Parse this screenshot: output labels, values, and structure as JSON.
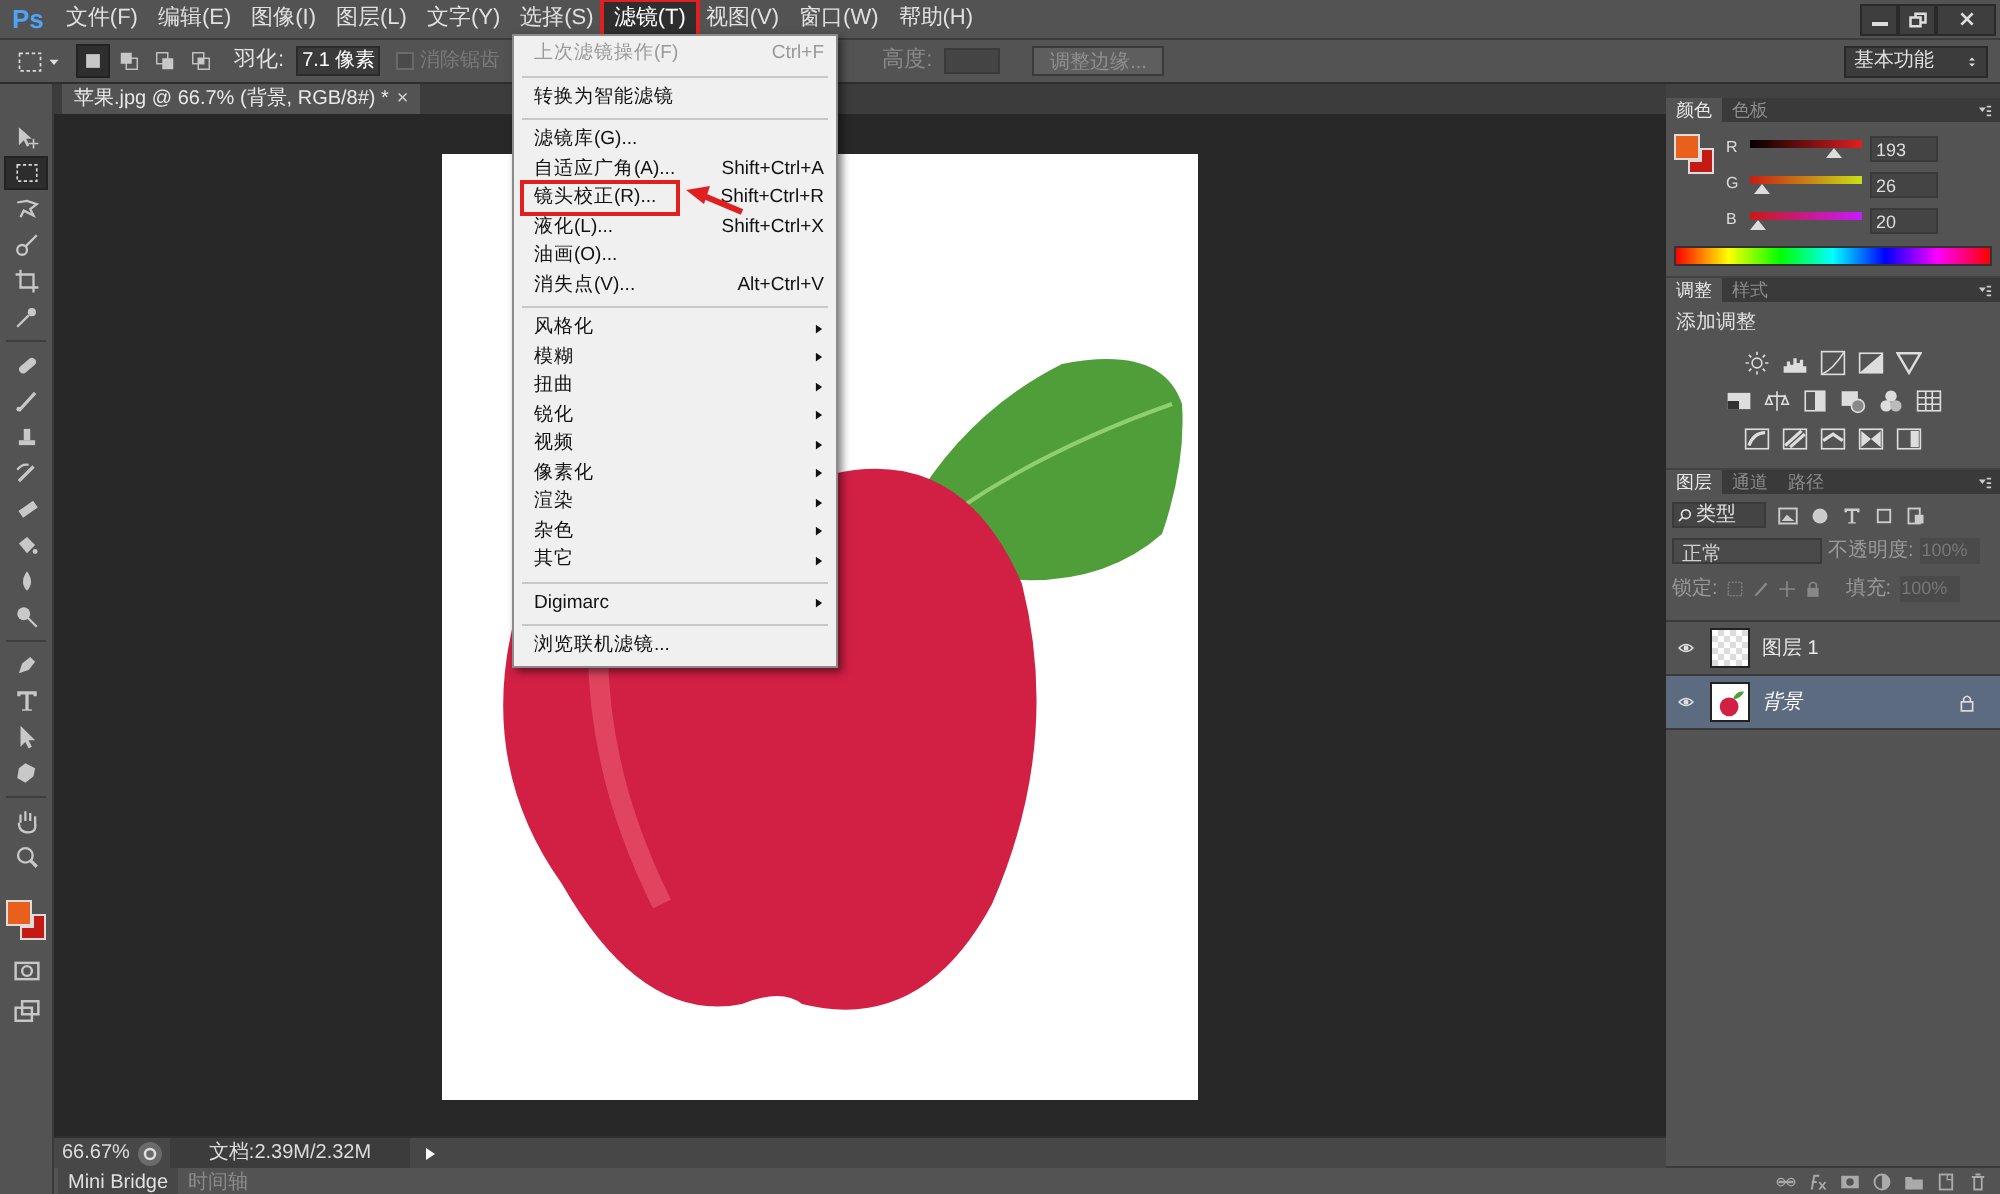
{
  "app_logo": "Ps",
  "menubar": [
    {
      "label": "文件(F)",
      "selected": false,
      "annotated": false
    },
    {
      "label": "编辑(E)",
      "selected": false,
      "annotated": false
    },
    {
      "label": "图像(I)",
      "selected": false,
      "annotated": false
    },
    {
      "label": "图层(L)",
      "selected": false,
      "annotated": false
    },
    {
      "label": "文字(Y)",
      "selected": false,
      "annotated": false
    },
    {
      "label": "选择(S)",
      "selected": false,
      "annotated": false
    },
    {
      "label": "滤镜(T)",
      "selected": true,
      "annotated": true
    },
    {
      "label": "视图(V)",
      "selected": false,
      "annotated": false
    },
    {
      "label": "窗口(W)",
      "selected": false,
      "annotated": false
    },
    {
      "label": "帮助(H)",
      "selected": false,
      "annotated": false
    }
  ],
  "options_bar": {
    "modes": [
      {
        "selected": true
      },
      {
        "selected": false
      },
      {
        "selected": false
      },
      {
        "selected": false
      }
    ],
    "feather_label": "羽化:",
    "feather_value": "7.1 像素",
    "antialias": {
      "label": "消除锯齿",
      "checked": false,
      "disabled": true
    },
    "height_label": "高度:",
    "refine_button": "调整边缘...",
    "workspace": "基本功能"
  },
  "document_tab": {
    "title": "苹果.jpg @ 66.7% (背景, RGB/8#) *",
    "close": "×"
  },
  "tools": [
    {
      "kind": "move",
      "selected": false
    },
    {
      "kind": "marquee",
      "selected": true
    },
    {
      "kind": "lasso",
      "selected": false
    },
    {
      "kind": "quick-select",
      "selected": false
    },
    {
      "kind": "crop",
      "selected": false
    },
    {
      "kind": "eyedropper",
      "selected": false
    },
    {
      "kind": "healing",
      "selected": false
    },
    {
      "kind": "brush",
      "selected": false
    },
    {
      "kind": "stamp",
      "selected": false
    },
    {
      "kind": "history-brush",
      "selected": false
    },
    {
      "kind": "eraser",
      "selected": false
    },
    {
      "kind": "bucket",
      "selected": false
    },
    {
      "kind": "blur",
      "selected": false
    },
    {
      "kind": "dodge",
      "selected": false
    },
    {
      "kind": "pen",
      "selected": false
    },
    {
      "kind": "type",
      "selected": false
    },
    {
      "kind": "path-select",
      "selected": false
    },
    {
      "kind": "shape",
      "selected": false
    },
    {
      "kind": "hand",
      "selected": false
    },
    {
      "kind": "zoom",
      "selected": false
    }
  ],
  "filter_menu": [
    {
      "kind": "item",
      "label": "上次滤镜操作(F)",
      "shortcut": "Ctrl+F",
      "disabled": true,
      "annotated": false
    },
    {
      "kind": "separator"
    },
    {
      "kind": "item",
      "label": "转换为智能滤镜",
      "disabled": false,
      "annotated": false
    },
    {
      "kind": "separator"
    },
    {
      "kind": "item",
      "label": "滤镜库(G)...",
      "disabled": false,
      "annotated": false
    },
    {
      "kind": "item",
      "label": "自适应广角(A)...",
      "shortcut": "Shift+Ctrl+A",
      "disabled": false,
      "annotated": false
    },
    {
      "kind": "item",
      "label": "镜头校正(R)...",
      "shortcut": "Shift+Ctrl+R",
      "disabled": false,
      "annotated": true
    },
    {
      "kind": "item",
      "label": "液化(L)...",
      "shortcut": "Shift+Ctrl+X",
      "disabled": false,
      "annotated": false
    },
    {
      "kind": "item",
      "label": "油画(O)...",
      "disabled": false,
      "annotated": false
    },
    {
      "kind": "item",
      "label": "消失点(V)...",
      "shortcut": "Alt+Ctrl+V",
      "disabled": false,
      "annotated": false
    },
    {
      "kind": "separator"
    },
    {
      "kind": "submenu",
      "label": "风格化"
    },
    {
      "kind": "submenu",
      "label": "模糊"
    },
    {
      "kind": "submenu",
      "label": "扭曲"
    },
    {
      "kind": "submenu",
      "label": "锐化"
    },
    {
      "kind": "submenu",
      "label": "视频"
    },
    {
      "kind": "submenu",
      "label": "像素化"
    },
    {
      "kind": "submenu",
      "label": "渲染"
    },
    {
      "kind": "submenu",
      "label": "杂色"
    },
    {
      "kind": "submenu",
      "label": "其它"
    },
    {
      "kind": "separator"
    },
    {
      "kind": "submenu",
      "label": "Digimarc"
    },
    {
      "kind": "separator"
    },
    {
      "kind": "item",
      "label": "浏览联机滤镜...",
      "disabled": false,
      "annotated": false
    }
  ],
  "color_panel": {
    "tabs": [
      {
        "label": "颜色",
        "selected": true
      },
      {
        "label": "色板",
        "selected": false
      }
    ],
    "channels": [
      {
        "name": "R",
        "value": "193",
        "level": 0.757
      },
      {
        "name": "G",
        "value": "26",
        "level": 0.102
      },
      {
        "name": "B",
        "value": "20",
        "level": 0.078
      }
    ]
  },
  "adjustments_panel": {
    "tabs": [
      {
        "label": "调整",
        "selected": true
      },
      {
        "label": "样式",
        "selected": false
      }
    ],
    "heading": "添加调整"
  },
  "layers_panel": {
    "tabs": [
      {
        "label": "图层",
        "selected": true
      },
      {
        "label": "通道",
        "selected": false
      },
      {
        "label": "路径",
        "selected": false
      }
    ],
    "filter_kind": "类型",
    "blend_mode": "正常",
    "opacity_label": "不透明度:",
    "opacity_value": "100%",
    "lock_label": "锁定:",
    "fill_label": "填充:",
    "fill_value": "100%",
    "layers": [
      {
        "name": "图层 1",
        "visible": true,
        "selected": false,
        "locked": false,
        "kind": "transparent"
      },
      {
        "name": "背景",
        "visible": true,
        "selected": true,
        "locked": true,
        "kind": "background"
      }
    ]
  },
  "status_bar": {
    "zoom": "66.67%",
    "doc_info": "文档:2.39M/2.32M"
  },
  "bottom_tabs": [
    {
      "label": "Mini Bridge",
      "selected": true
    },
    {
      "label": "时间轴",
      "selected": false
    }
  ]
}
